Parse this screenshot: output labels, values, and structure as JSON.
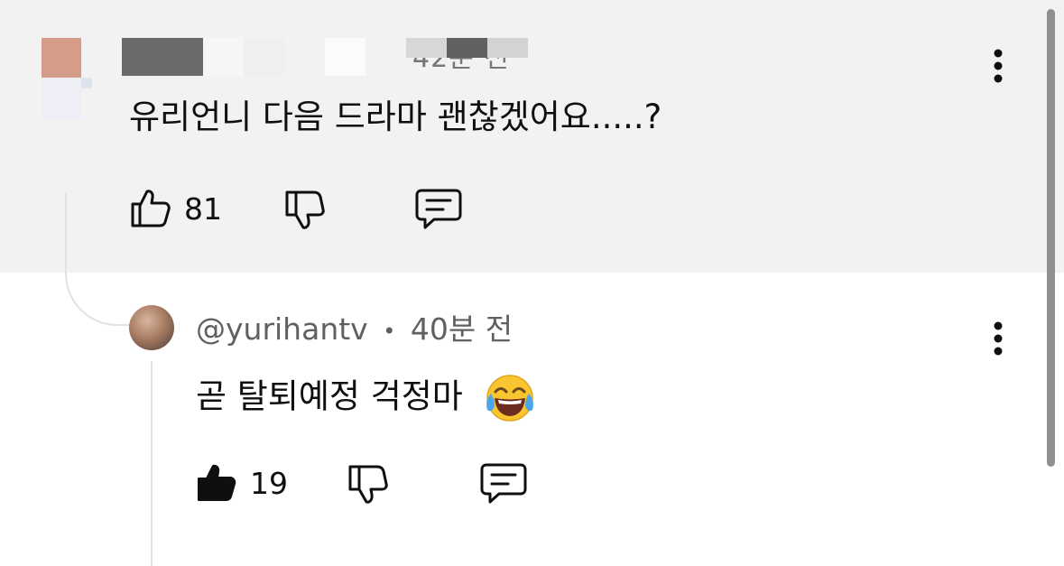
{
  "parent_comment": {
    "timestamp": "42분 전",
    "text": "유리언니 다음 드라마 괜찮겠어요.....?",
    "like_count": "81"
  },
  "reply": {
    "author": "@yurihantv",
    "separator": "•",
    "timestamp": "40분 전",
    "text": "곧 탈퇴예정 걱정마",
    "emoji": "face-with-tears-of-joy",
    "like_count": "19"
  },
  "colors": {
    "highlight_background": "#f2f2f2",
    "text_primary": "#0f0f0f",
    "text_secondary": "#606060",
    "thread_line": "#e2e2e2"
  }
}
